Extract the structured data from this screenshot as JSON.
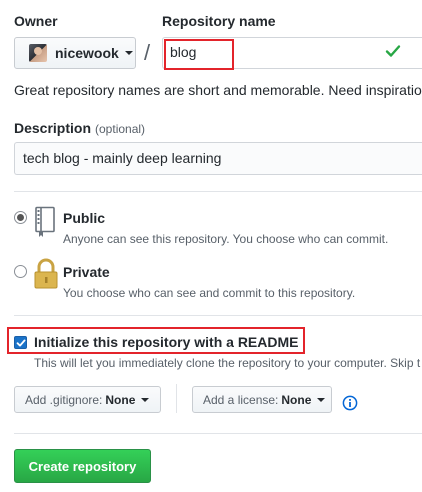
{
  "owner": {
    "label": "Owner",
    "value": "nicewook"
  },
  "repository": {
    "label": "Repository name",
    "value": "blog",
    "hint": "Great repository names are short and memorable. Need inspiration"
  },
  "description": {
    "label": "Description",
    "optional": "(optional)",
    "value": "tech blog - mainly deep learning"
  },
  "visibility": {
    "options": [
      {
        "title": "Public",
        "desc": "Anyone can see this repository. You choose who can commit.",
        "selected": true
      },
      {
        "title": "Private",
        "desc": "You choose who can see and commit to this repository.",
        "selected": false
      }
    ]
  },
  "readme": {
    "label": "Initialize this repository with a README",
    "desc": "This will let you immediately clone the repository to your computer. Skip t",
    "checked": true
  },
  "gitignore": {
    "prefix": "Add .gitignore:",
    "value": "None"
  },
  "license": {
    "prefix": "Add a license:",
    "value": "None"
  },
  "create_button": "Create repository",
  "colors": {
    "accent_green": "#28a745",
    "highlight_red": "#e3242b",
    "check_blue": "#1a73c9"
  },
  "icons": {
    "valid": "check-icon",
    "public": "repo-book-icon",
    "private": "lock-icon",
    "info": "info-icon"
  }
}
